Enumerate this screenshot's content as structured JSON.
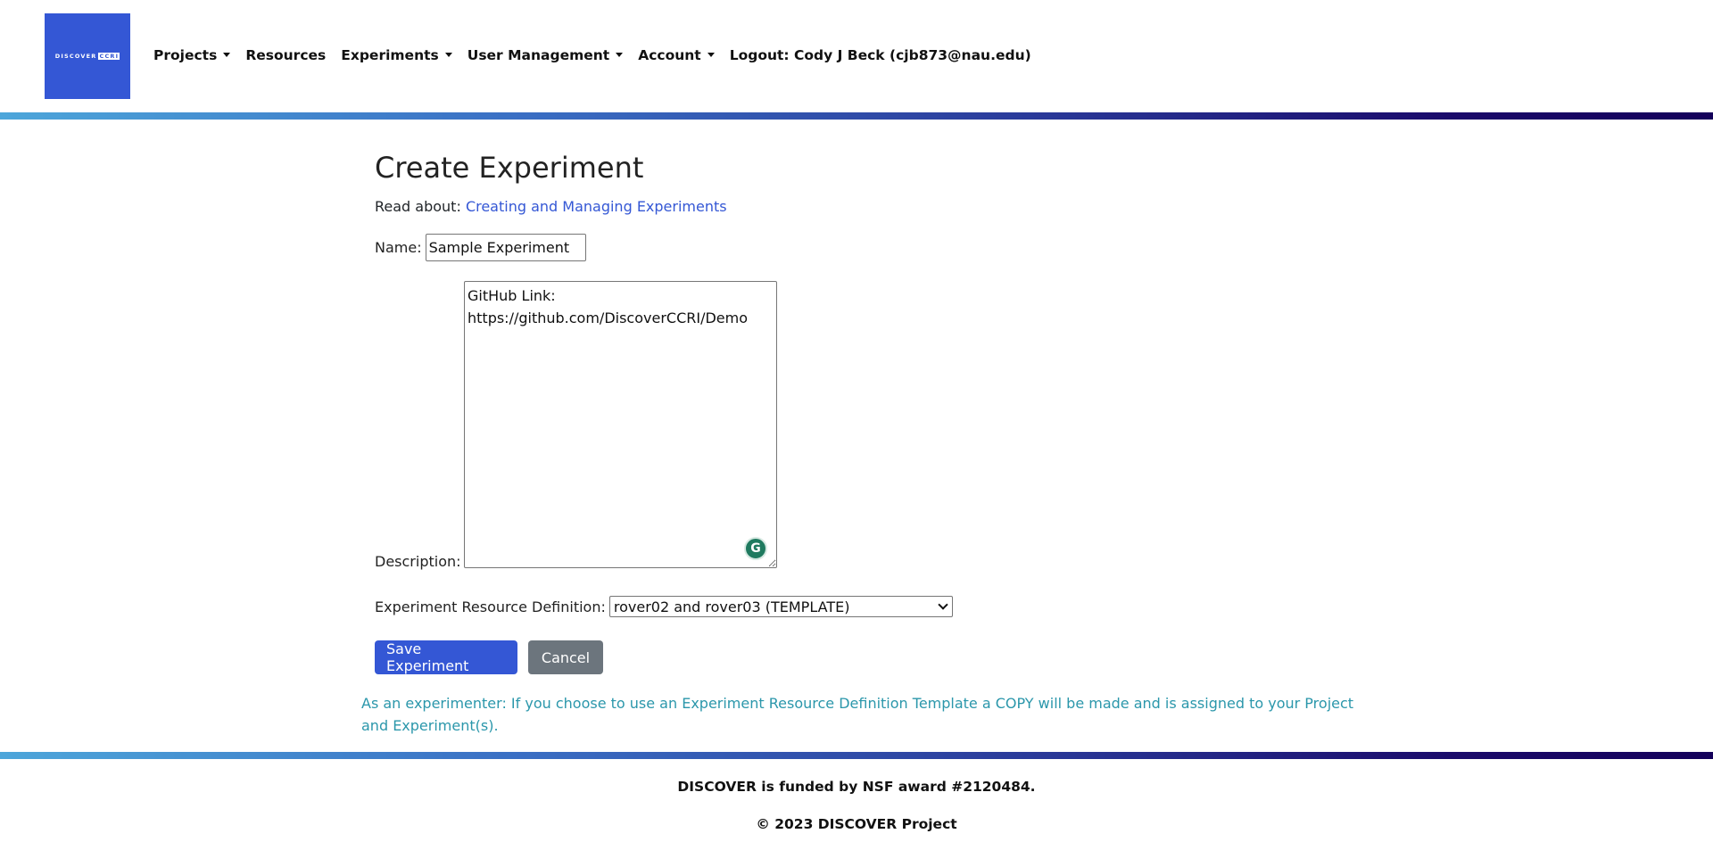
{
  "nav": {
    "logo_text": "DISCOVER",
    "logo_badge": "CCRI",
    "items": [
      {
        "label": "Projects",
        "dropdown": true
      },
      {
        "label": "Resources",
        "dropdown": false
      },
      {
        "label": "Experiments",
        "dropdown": true
      },
      {
        "label": "User Management",
        "dropdown": true
      },
      {
        "label": "Account",
        "dropdown": true
      },
      {
        "label": "Logout: Cody J Beck (cjb873@nau.edu)",
        "dropdown": false
      }
    ]
  },
  "page": {
    "title": "Create Experiment",
    "read_about_label": "Read about: ",
    "read_about_link": "Creating and Managing Experiments",
    "name_label": "Name:",
    "name_value": "Sample Experiment",
    "description_label": "Description:",
    "description_value": "GitHub Link:\nhttps://github.com/DiscoverCCRI/Demo",
    "erd_label": "Experiment Resource Definition:",
    "erd_selected": "rover02 and rover03 (TEMPLATE)",
    "save_label": "Save Experiment",
    "cancel_label": "Cancel",
    "note": "As an experimenter: If you choose to use an Experiment Resource Definition Template a COPY will be made and is assigned to your Project and Experiment(s)."
  },
  "footer": {
    "funding": "DISCOVER is funded by NSF award #2120484.",
    "copyright": "© 2023 DISCOVER Project"
  },
  "colors": {
    "brand_blue": "#3457d5",
    "secondary_gray": "#6c757d",
    "note_teal": "#2b97ab",
    "gradient": [
      "#4da6da",
      "#14005a"
    ]
  },
  "icons": {
    "grammarly": "grammarly-icon",
    "dropdown": "caret-down-icon"
  }
}
